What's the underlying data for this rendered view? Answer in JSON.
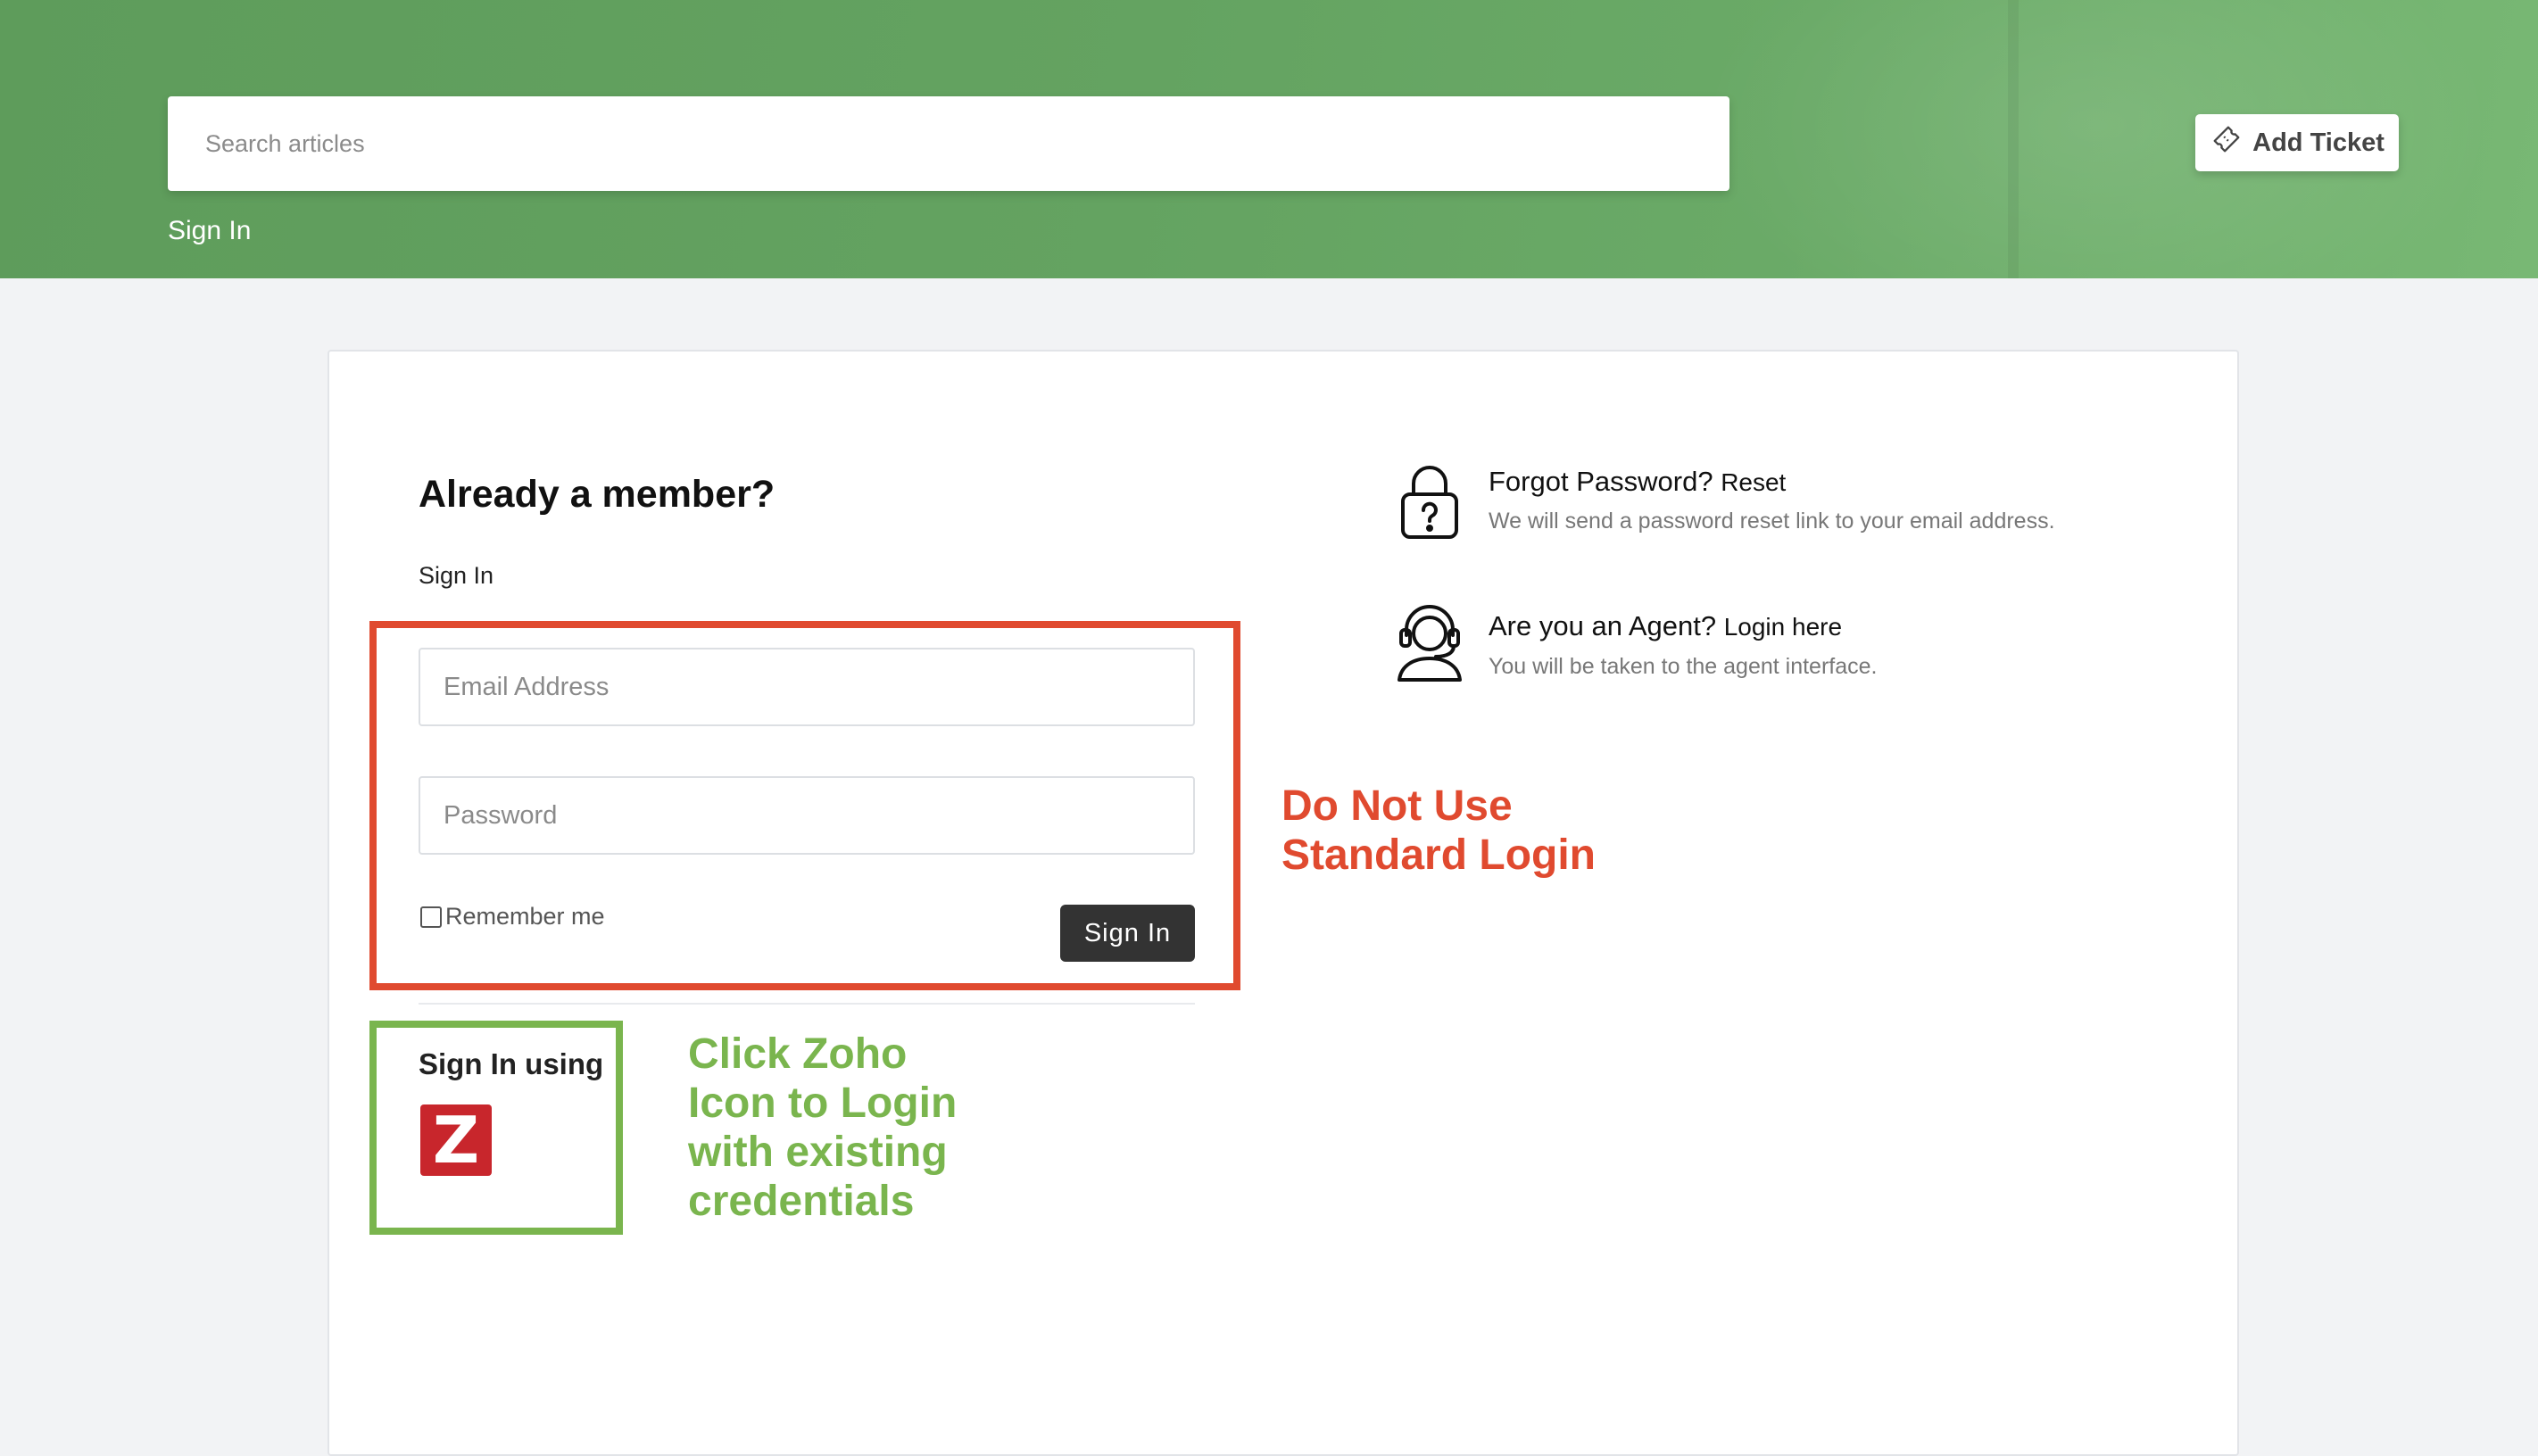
{
  "header": {
    "search": {
      "placeholder": "Search articles"
    },
    "signin_link": "Sign In",
    "add_ticket_label": "Add Ticket"
  },
  "login": {
    "heading": "Already a member?",
    "signin_label": "Sign In",
    "email_placeholder": "Email Address",
    "password_placeholder": "Password",
    "remember_label": "Remember me",
    "remember_checked": false,
    "signin_button": "Sign In",
    "signin_using_label": "Sign In using",
    "zoho_icon": "Z"
  },
  "side": {
    "forgot": {
      "title": "Forgot Password?",
      "link": "Reset",
      "description": "We will send a password reset link to your email address."
    },
    "agent": {
      "title": "Are you an Agent?",
      "link": "Login here",
      "description": "You will be taken to the agent interface."
    }
  },
  "annotations": {
    "red_note": [
      "Do Not Use",
      "Standard Login"
    ],
    "green_note": [
      "Click Zoho",
      "Icon to Login",
      "with existing",
      "credentials"
    ],
    "red_color": "#e04a2f",
    "green_color": "#7ab54e"
  },
  "colors": {
    "banner": "#64a361",
    "button_dark": "#333333",
    "zoho_red": "#c8262c"
  }
}
